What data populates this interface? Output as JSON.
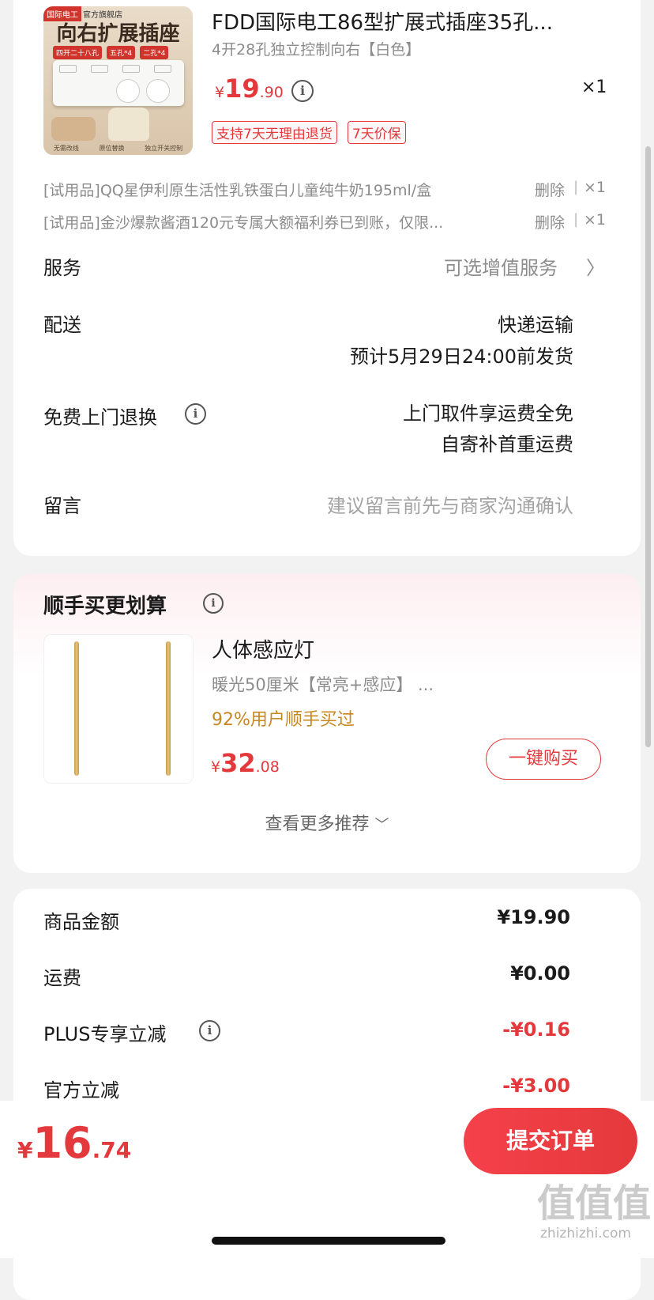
{
  "product": {
    "img_brand": "国际电工",
    "img_store": "官方旗舰店",
    "img_headline": "向右扩展插座",
    "img_badges": [
      "四开二十八孔",
      "五孔*4",
      "二孔*4"
    ],
    "img_features": [
      "无需改线",
      "原位替换",
      "独立开关控制"
    ],
    "title": "FDD国际电工86型扩展式插座35孔...",
    "spec": "4开28孔独立控制向右【白色】",
    "price_symbol": "¥",
    "price_int": "19",
    "price_dec": ".90",
    "qty": "×1",
    "tags": [
      "支持7天无理由退货",
      "7天价保"
    ]
  },
  "trials": [
    {
      "label": "[试用品]QQ星伊利原生活性乳铁蛋白儿童纯牛奶195ml/盒",
      "action": "删除",
      "sep": "|",
      "qty": "×1"
    },
    {
      "label": "[试用品]金沙爆款酱酒120元专属大额福利券已到账，仅限...",
      "action": "删除",
      "sep": "|",
      "qty": "×1"
    }
  ],
  "service": {
    "label": "服务",
    "value": "可选增值服务"
  },
  "delivery": {
    "label": "配送",
    "method": "快递运输",
    "estimate": "预计5月29日24:00前发货"
  },
  "return_service": {
    "label": "免费上门退换",
    "line1": "上门取件享运费全免",
    "line2": "自寄补首重运费"
  },
  "message": {
    "label": "留言",
    "placeholder": "建议留言前先与商家沟通确认"
  },
  "bundle": {
    "title": "顺手买更划算",
    "item_name": "人体感应灯",
    "item_spec": "暖光50厘米【常亮+感应】 ...",
    "item_social": "92%用户顺手买过",
    "price_symbol": "¥",
    "price_int": "32",
    "price_dec": ".08",
    "buy_label": "一键购买",
    "more_label": "查看更多推荐"
  },
  "summary": {
    "rows": [
      {
        "label": "商品金额",
        "value": "¥19.90",
        "info": false,
        "discount": false
      },
      {
        "label": "运费",
        "value": "¥0.00",
        "info": false,
        "discount": false
      },
      {
        "label": "PLUS专享立减",
        "value": "-¥0.16",
        "info": true,
        "discount": true
      },
      {
        "label": "官方立减",
        "value": "-¥3.00",
        "info": false,
        "discount": true
      }
    ]
  },
  "footer": {
    "price_symbol": "¥",
    "total_int": "16",
    "total_dec": ".74",
    "submit_label": "提交订单"
  },
  "watermark": {
    "text": "值值值",
    "url": "zhizhizhi.com"
  },
  "colors": {
    "accent": "#e4393c",
    "social_orange": "#c8871f"
  }
}
